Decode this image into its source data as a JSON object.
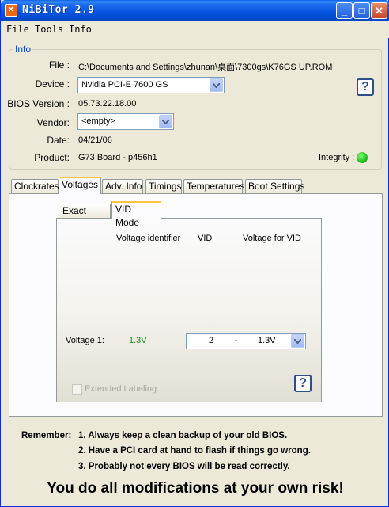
{
  "window": {
    "title": "NiBiTor 2.9",
    "app_icon": "app-icon",
    "controls": {
      "minimize": "_",
      "maximize": "□",
      "close": "✕"
    }
  },
  "menu": [
    "File",
    "Tools",
    "Info"
  ],
  "info": {
    "group_title": "Info",
    "file_label": "File :",
    "file_value": "C:\\Documents and Settings\\zhunan\\桌面\\7300gs\\K76GS UP.ROM",
    "device_label": "Device :",
    "device_value": "Nvidia PCI-E 7600 GS",
    "bios_label": "BIOS Version :",
    "bios_value": "05.73.22.18.00",
    "vendor_label": "Vendor:",
    "vendor_value": "<empty>",
    "date_label": "Date:",
    "date_value": "04/21/06",
    "product_label": "Product:",
    "product_value": "G73 Board - p456h1",
    "integrity_label": "Integrity :",
    "integrity_color": "#1fc01f",
    "help": "?"
  },
  "tabs": [
    "Clockrates",
    "Voltages",
    "Adv. Info",
    "Timings",
    "Temperatures",
    "Boot Settings"
  ],
  "active_tab": "Voltages",
  "subtabs": [
    "Exact Mode",
    "VID Mode"
  ],
  "active_subtab": "VID Mode",
  "vid": {
    "col_voltage_identifier": "Voltage identifier",
    "col_vid": "VID",
    "col_voltage_for_vid": "Voltage for VID",
    "row_label": "Voltage 1:",
    "row_voltage": "1.3V",
    "select_vid": "2",
    "select_sep": "-",
    "select_voltage": "1.3V",
    "extended_labeling": "Extended Labeling",
    "help": "?"
  },
  "notes": {
    "prefix": "Remember:",
    "line1": "1. Always keep a clean backup of your old BIOS.",
    "line2": "2. Have a PCI card at hand to flash if things go wrong.",
    "line3": "3. Probably not every BIOS will be read correctly."
  },
  "warning": "You do all modifications at your own risk!"
}
